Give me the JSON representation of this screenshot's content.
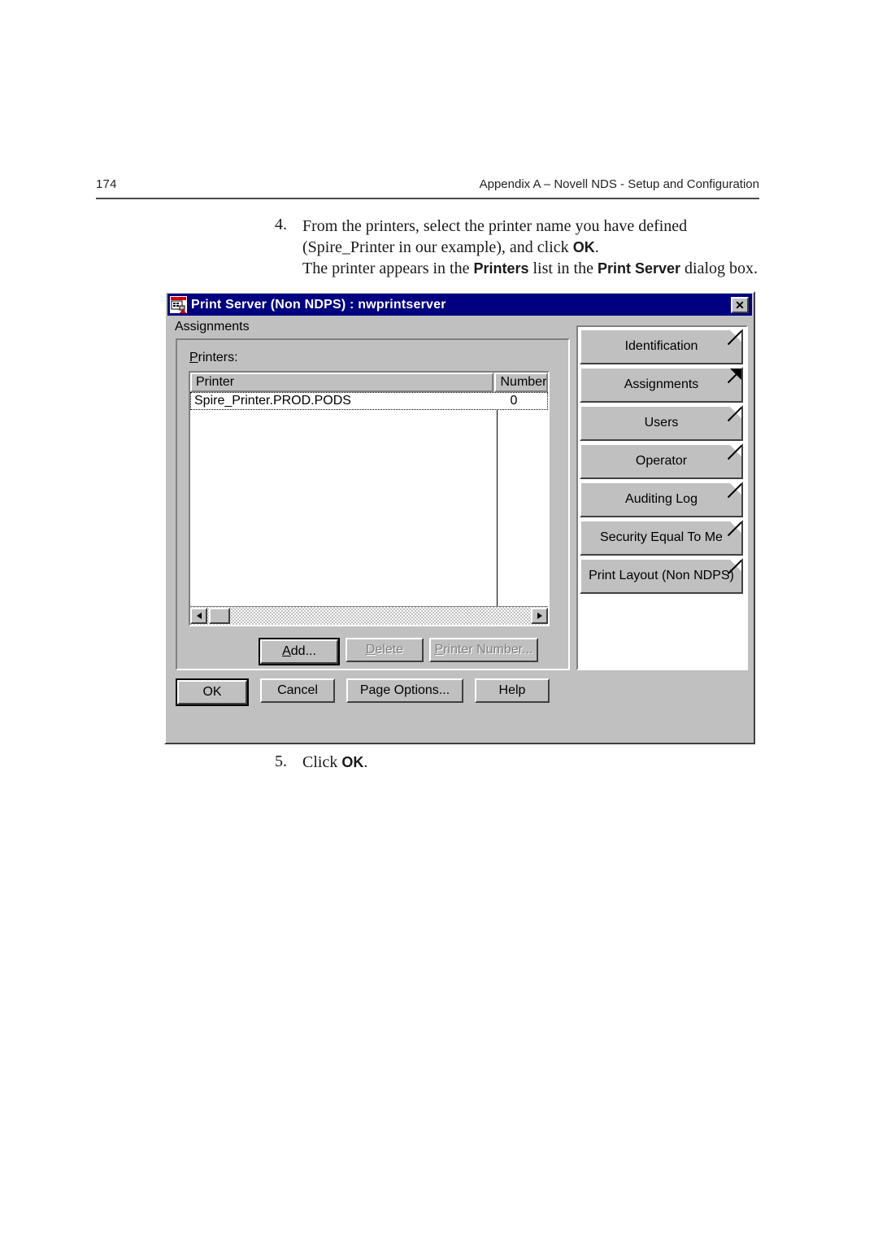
{
  "page": {
    "number": "174",
    "header_title": "Appendix A – Novell NDS - Setup and Configuration"
  },
  "steps": [
    {
      "number": "4.",
      "line1_a": "From the printers, select the printer name you have defined",
      "line2_a": "(Spire_Printer in our example), and click ",
      "line2_b": "OK",
      "line2_c": ".",
      "line3_a": "The printer appears in the ",
      "line3_b": "Printers",
      "line3_c": " list in the ",
      "line3_d": "Print Server",
      "line3_e": " dialog box."
    },
    {
      "number": "5.",
      "line1_a": "Click ",
      "line1_b": "OK",
      "line1_c": "."
    }
  ],
  "dialog": {
    "title": "Print Server (Non NDPS) : nwprintserver",
    "title_icon": "print-server-icon",
    "close_label": "✕",
    "group_label": "Assignments",
    "printers_label_accel": "P",
    "printers_label_rest": "rinters:",
    "list": {
      "columns": [
        "Printer",
        "Number"
      ],
      "rows": [
        {
          "printer": "Spire_Printer.PROD.PODS",
          "number": "0"
        }
      ]
    },
    "scrollbar": {
      "left_arrow": "scroll-left-arrow-icon",
      "right_arrow": "scroll-right-arrow-icon"
    },
    "panel_actions": [
      {
        "accel": "A",
        "rest": "dd...",
        "state": "default"
      },
      {
        "accel": "D",
        "rest": "elete",
        "state": "disabled"
      },
      {
        "accel": "P",
        "rest": "rinter Number...",
        "state": "disabled"
      }
    ],
    "tabs": [
      {
        "label": "Identification",
        "selected": false
      },
      {
        "label": "Assignments",
        "selected": true
      },
      {
        "label": "Users",
        "selected": false
      },
      {
        "label": "Operator",
        "selected": false
      },
      {
        "label": "Auditing Log",
        "selected": false
      },
      {
        "label": "Security Equal To Me",
        "selected": false
      },
      {
        "label": "Print Layout (Non NDPS)",
        "selected": false
      }
    ],
    "bottom_buttons": [
      {
        "label": "OK",
        "state": "default"
      },
      {
        "label": "Cancel",
        "state": "normal"
      },
      {
        "label": "Page Options...",
        "state": "normal"
      },
      {
        "label": "Help",
        "state": "normal"
      }
    ]
  },
  "colors": {
    "titlebar": "#000080",
    "dialog_face": "#c0c0c0",
    "shadow": "#404040",
    "highlight": "#ffffff",
    "text": "#000000",
    "disabled_text": "#808080"
  }
}
